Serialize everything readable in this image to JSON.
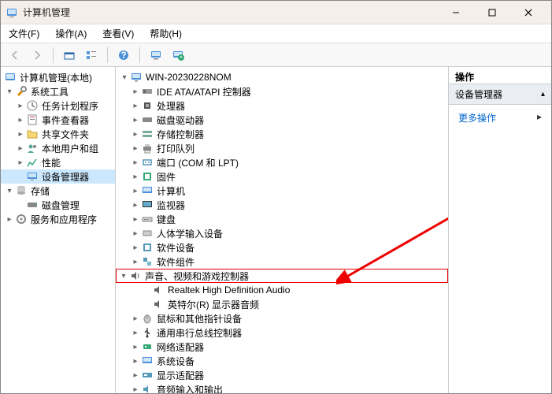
{
  "window": {
    "title": "计算机管理"
  },
  "menu": {
    "file": "文件(F)",
    "action": "操作(A)",
    "view": "查看(V)",
    "help": "帮助(H)"
  },
  "left_tree": {
    "root": "计算机管理(本地)",
    "sys_tools": "系统工具",
    "task_sched": "任务计划程序",
    "event_viewer": "事件查看器",
    "shared": "共享文件夹",
    "local_users": "本地用户和组",
    "perf": "性能",
    "devmgr": "设备管理器",
    "storage": "存储",
    "disk": "磁盘管理",
    "services": "服务和应用程序"
  },
  "mid_tree": {
    "root": "WIN-20230228NOM",
    "ide": "IDE ATA/ATAPI 控制器",
    "cpu": "处理器",
    "diskdrive": "磁盘驱动器",
    "storagectrl": "存储控制器",
    "printqueue": "打印队列",
    "ports": "端口 (COM 和 LPT)",
    "firmware": "固件",
    "computer": "计算机",
    "monitor": "监视器",
    "keyboard": "键盘",
    "hid": "人体学输入设备",
    "swdev": "软件设备",
    "swcomp": "软件组件",
    "sound": "声音、视频和游戏控制器",
    "sound_child1": "Realtek High Definition Audio",
    "sound_child2": "英特尔(R) 显示器音频",
    "mouse": "鼠标和其他指针设备",
    "usb": "通用串行总线控制器",
    "network": "网络适配器",
    "sysdev": "系统设备",
    "display": "显示适配器",
    "audioio": "音频输入和输出"
  },
  "actions": {
    "header": "操作",
    "sub": "设备管理器",
    "more": "更多操作"
  }
}
